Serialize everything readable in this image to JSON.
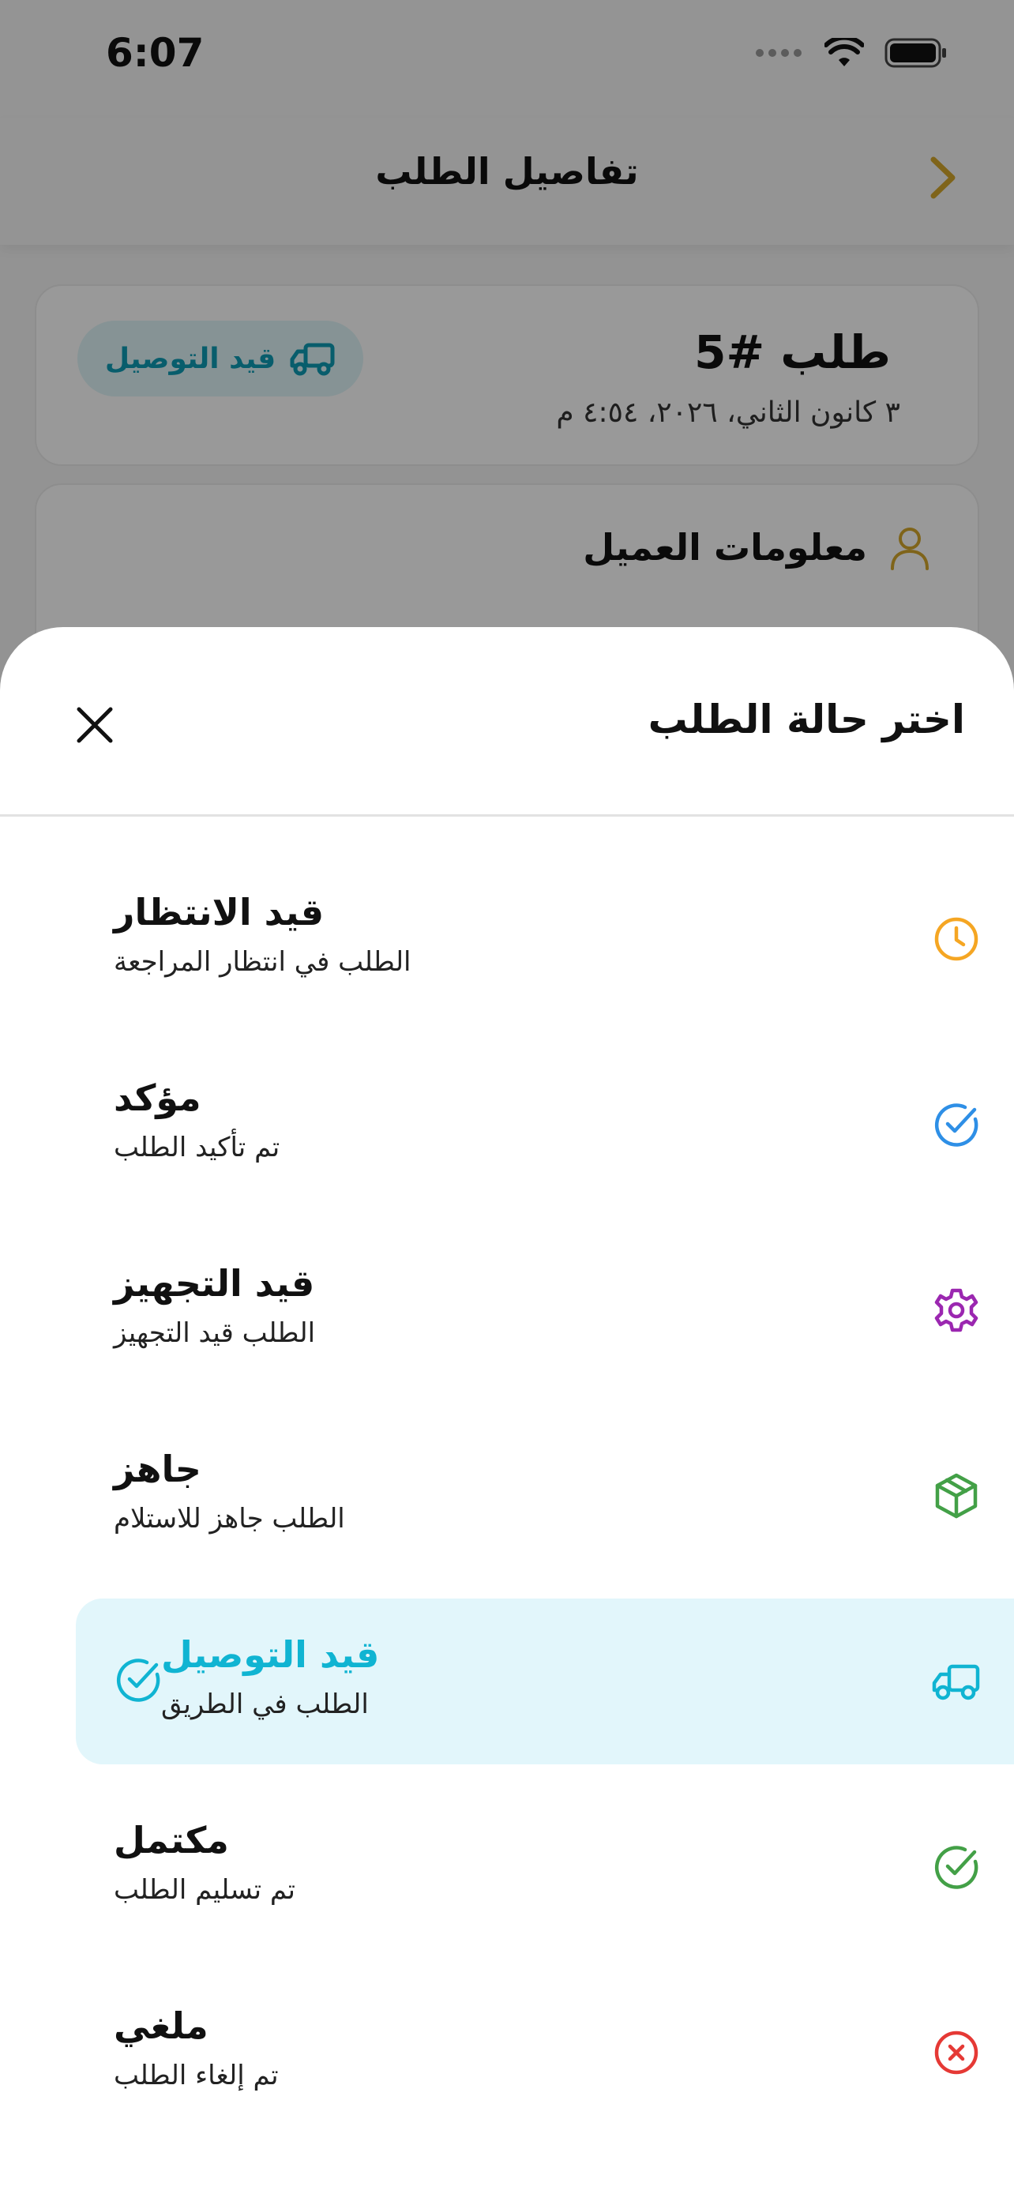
{
  "status_bar": {
    "time": "6:07"
  },
  "nav": {
    "title": "تفاصيل الطلب"
  },
  "order": {
    "title": "طلب #5",
    "date": "٣ كانون الثاني، ٢٠٢٦، ٤:٥٤ م",
    "status_badge": "قيد التوصيل"
  },
  "customer": {
    "section_title": "معلومات العميل"
  },
  "sheet": {
    "title": "اختر حالة الطلب",
    "options": [
      {
        "label": "قيد الانتظار",
        "description": "الطلب في انتظار المراجعة",
        "icon": "clock-icon",
        "color": "#F5A623"
      },
      {
        "label": "مؤكد",
        "description": "تم تأكيد الطلب",
        "icon": "check-circle-icon",
        "color": "#2E8FE6"
      },
      {
        "label": "قيد التجهيز",
        "description": "الطلب قيد التجهيز",
        "icon": "gear-icon",
        "color": "#9B27B0"
      },
      {
        "label": "جاهز",
        "description": "الطلب جاهز للاستلام",
        "icon": "box-icon",
        "color": "#43A047"
      },
      {
        "label": "قيد التوصيل",
        "description": "الطلب في الطريق",
        "icon": "truck-icon",
        "color": "#10B4D2",
        "selected": true
      },
      {
        "label": "مكتمل",
        "description": "تم تسليم الطلب",
        "icon": "check-circle-icon",
        "color": "#43A047"
      },
      {
        "label": "ملغي",
        "description": "تم إلغاء الطلب",
        "icon": "x-circle-icon",
        "color": "#E53935"
      }
    ]
  },
  "colors": {
    "accent": "#10B4D2",
    "back_arrow": "#D4A72C",
    "selected_bg": "#E2F6FB"
  }
}
